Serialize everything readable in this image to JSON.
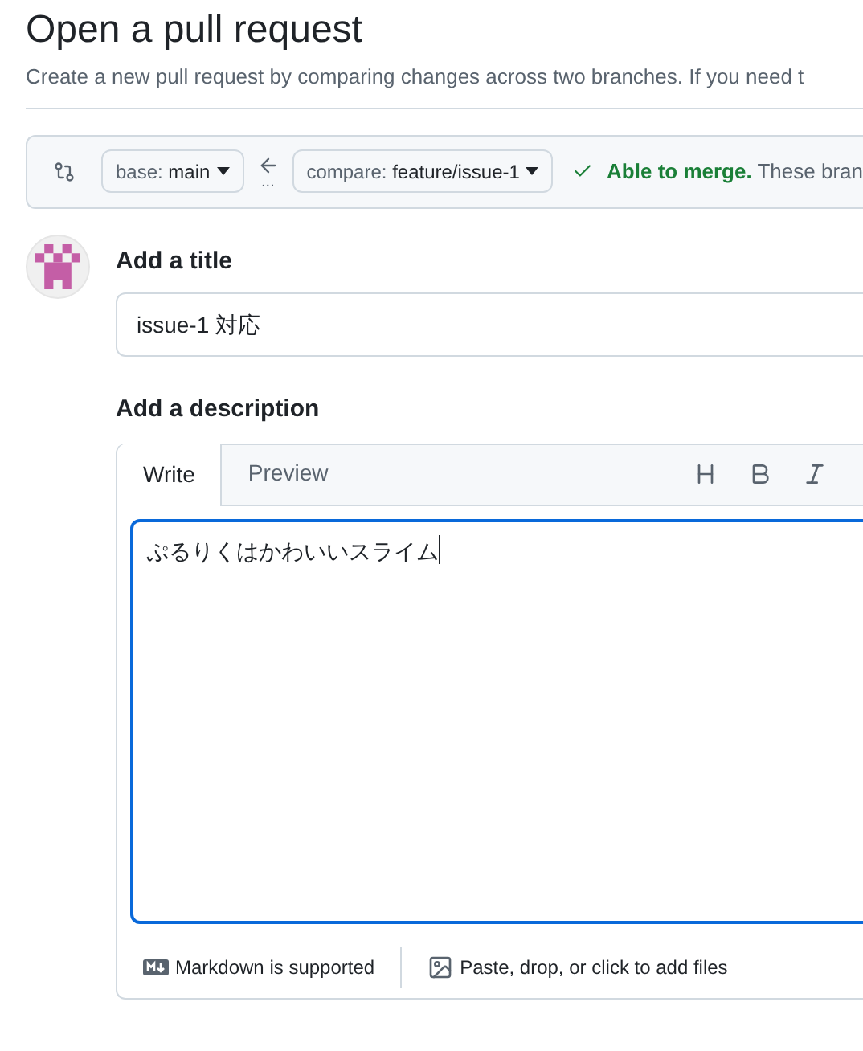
{
  "page": {
    "title": "Open a pull request",
    "subtitle": "Create a new pull request by comparing changes across two branches. If you need t"
  },
  "compare_bar": {
    "base": {
      "prefix": "base:",
      "branch": "main"
    },
    "compare": {
      "prefix": "compare:",
      "branch": "feature/issue-1"
    },
    "swap_dots": "...",
    "status": {
      "strong": "Able to merge.",
      "text": "These bran"
    }
  },
  "title_field": {
    "label": "Add a title",
    "value": "issue-1 対応"
  },
  "description": {
    "label": "Add a description",
    "tabs": [
      {
        "label": "Write",
        "selected": true
      },
      {
        "label": "Preview",
        "selected": false
      }
    ],
    "toolbar": [
      {
        "kind": "heading"
      },
      {
        "kind": "bold"
      },
      {
        "kind": "italic"
      }
    ],
    "value": "ぷるりくはかわいいスライム",
    "footer": {
      "markdown": "Markdown is supported",
      "attach": "Paste, drop, or click to add files"
    }
  }
}
